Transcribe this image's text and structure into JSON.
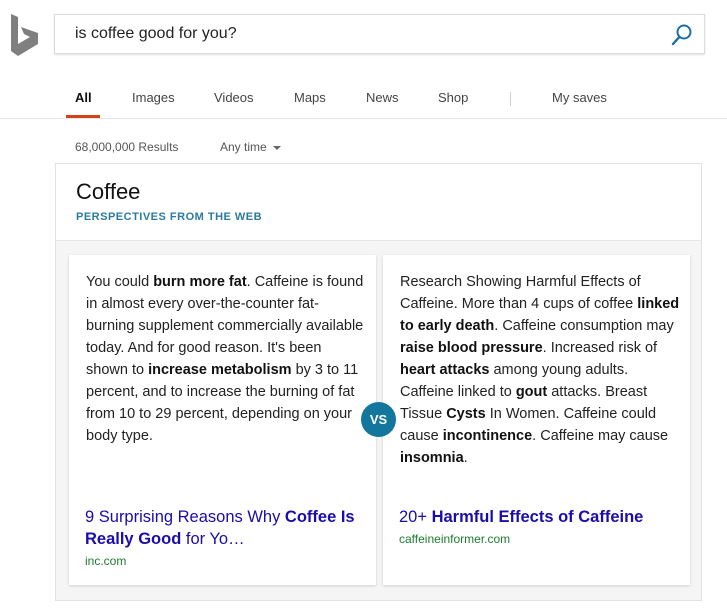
{
  "search": {
    "query": "is coffee good for you?"
  },
  "nav": {
    "tabs": [
      {
        "label": "All",
        "active": true
      },
      {
        "label": "Images"
      },
      {
        "label": "Videos"
      },
      {
        "label": "Maps"
      },
      {
        "label": "News"
      },
      {
        "label": "Shop"
      },
      {
        "label": "My saves"
      }
    ]
  },
  "results": {
    "count": "68,000,000 Results",
    "time_filter": "Any time"
  },
  "card": {
    "title": "Coffee",
    "subtitle": "PERSPECTIVES FROM THE WEB",
    "vs_label": "VS",
    "left": {
      "html": "You could <b>burn more fat</b>. Caffeine is found in almost every over-the-counter fat-burning supplement commercially available today. And for good reason. It's been shown to <b>increase metabolism</b> by 3 to 11 percent, and to increase the burning of fat from 10 to 29 percent, depending on your body type.",
      "link_html": "9 Surprising Reasons Why <b>Coffee Is Really Good</b> for Yo…",
      "domain": "inc.com"
    },
    "right": {
      "html": "Research Showing Harmful Effects of Caffeine. More than 4 cups of coffee <b>linked to early death</b>. Caffeine consumption may <b>raise blood pressure</b>. Increased risk of <b>heart attacks</b> among young adults. Caffeine linked to <b>gout</b> attacks. Breast Tissue <b>Cysts</b> In Women. Caffeine could cause <b>incontinence</b>. Caffeine may cause <b>insomnia</b>.",
      "link_html": "20+ <b>Harmful Effects of Caffeine</b>",
      "domain": "caffeineinformer.com"
    }
  },
  "colors": {
    "accent_underline": "#d34217",
    "vs_badge": "#13769c",
    "link": "#1a0dab",
    "domain": "#1e7b30",
    "subtitle": "#2b7ba0"
  },
  "icons": {
    "logo": "bing-logo",
    "search": "search-icon",
    "dropdown": "caret-down-icon"
  }
}
